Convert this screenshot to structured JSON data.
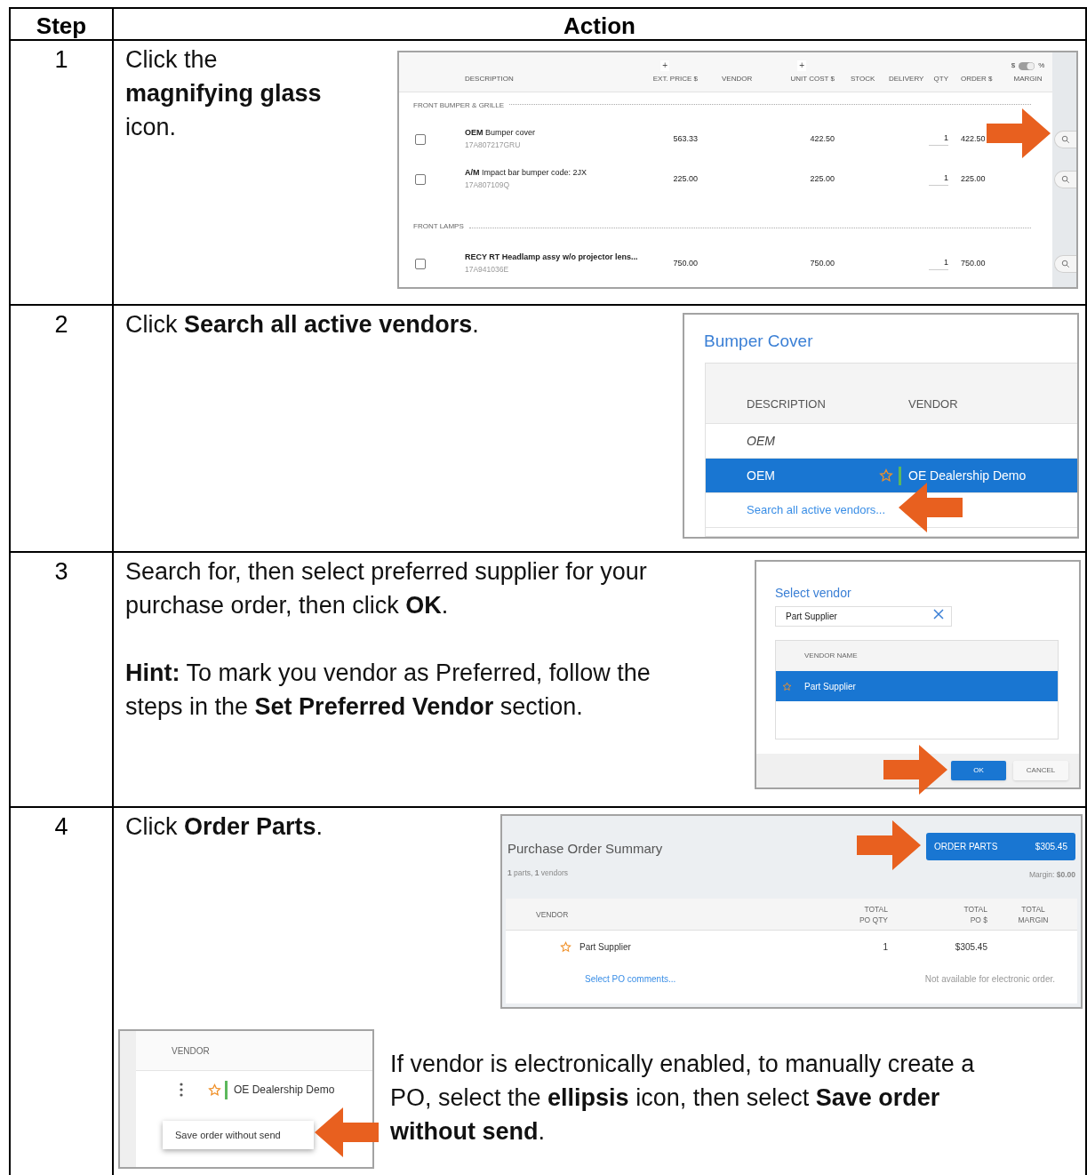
{
  "table": {
    "columns": [
      "Step",
      "Action"
    ]
  },
  "steps": [
    {
      "number": "1",
      "paragraphs": [
        "Click the **magnifying glass** icon."
      ],
      "screenshot": {
        "kind": "parts_grid",
        "columns": [
          {
            "label": "DESCRIPTION"
          },
          {
            "label": "EXT. PRICE $",
            "above": "+"
          },
          {
            "label": "VENDOR"
          },
          {
            "label": "UNIT COST $",
            "above": "+"
          },
          {
            "label": "STOCK"
          },
          {
            "label": "DELIVERY"
          },
          {
            "label": "QTY"
          },
          {
            "label": "ORDER $"
          },
          {
            "label": "MARGIN",
            "toggle": {
              "left": "$",
              "right": "%",
              "on": true
            }
          }
        ],
        "sections": [
          {
            "title": "FRONT BUMPER & GRILLE",
            "rows": [
              {
                "name": "**OEM** Bumper cover",
                "bold": false,
                "part_number": "17A807217GRU",
                "ext_price": "563.33",
                "unit_cost": "422.50",
                "qty": "1",
                "order": "422.50",
                "checked": false
              },
              {
                "name": "**A/M** Impact bar bumper code: 2JX",
                "bold": false,
                "part_number": "17A807109Q",
                "ext_price": "225.00",
                "unit_cost": "225.00",
                "qty": "1",
                "order": "225.00",
                "checked": false
              }
            ]
          },
          {
            "title": "FRONT LAMPS",
            "rows": [
              {
                "name": "RECY RT Headlamp assy w/o projector lens...",
                "bold": true,
                "part_number": "17A941036E",
                "ext_price": "750.00",
                "unit_cost": "750.00",
                "qty": "1",
                "order": "750.00",
                "checked": false
              }
            ]
          }
        ]
      }
    },
    {
      "number": "2",
      "paragraphs": [
        "Click **Search all active vendors**."
      ],
      "screenshot": {
        "kind": "vendor_picker",
        "title": "Bumper Cover",
        "columns": [
          "DESCRIPTION",
          "VENDOR"
        ],
        "rows": [
          {
            "kind": "group",
            "description": "OEM",
            "selected": false
          },
          {
            "kind": "vendor",
            "description": "OEM",
            "vendor": "OE Dealership Demo",
            "selected": true
          },
          {
            "kind": "link",
            "label": "Search all active vendors...",
            "selected": false
          }
        ]
      }
    },
    {
      "number": "3",
      "paragraphs": [
        "Search for, then select preferred supplier for your purchase order, then click **OK**.",
        "**Hint:** To mark you vendor as Preferred, follow the steps in the **Set Preferred Vendor** section."
      ],
      "screenshot": {
        "kind": "select_vendor",
        "title": "Select vendor",
        "search_value": "Part Supplier",
        "column": "VENDOR NAME",
        "rows": [
          {
            "name": "Part Supplier",
            "selected": true
          }
        ],
        "buttons": [
          {
            "label": "OK",
            "kind": "primary"
          },
          {
            "label": "CANCEL",
            "kind": "secondary"
          }
        ]
      }
    },
    {
      "number": "4",
      "paragraphs": [
        "Click **Order Parts**."
      ],
      "screenshot": {
        "kind": "po_summary",
        "title": "Purchase Order Summary",
        "subtitle": "**1** parts, **1** vendors",
        "button": {
          "label": "ORDER PARTS",
          "amount": "$305.45"
        },
        "margin": "Margin: **$0.00**",
        "columns": [
          "VENDOR",
          "TOTAL PO QTY",
          "TOTAL PO $",
          "TOTAL MARGIN"
        ],
        "rows": [
          {
            "vendor": "Part Supplier",
            "qty": "1",
            "total": "$305.45",
            "link": "Select PO comments...",
            "note": "Not available for electronic order."
          }
        ]
      },
      "extra": {
        "paragraphs": [
          "If vendor is electronically enabled, to manually create a PO, select the **ellipsis** icon, then select **Save order without send**."
        ],
        "screenshot": {
          "kind": "vendor_menu",
          "column": "VENDOR",
          "vendor": "OE Dealership Demo",
          "menu_item": "Save order without send"
        }
      }
    }
  ]
}
